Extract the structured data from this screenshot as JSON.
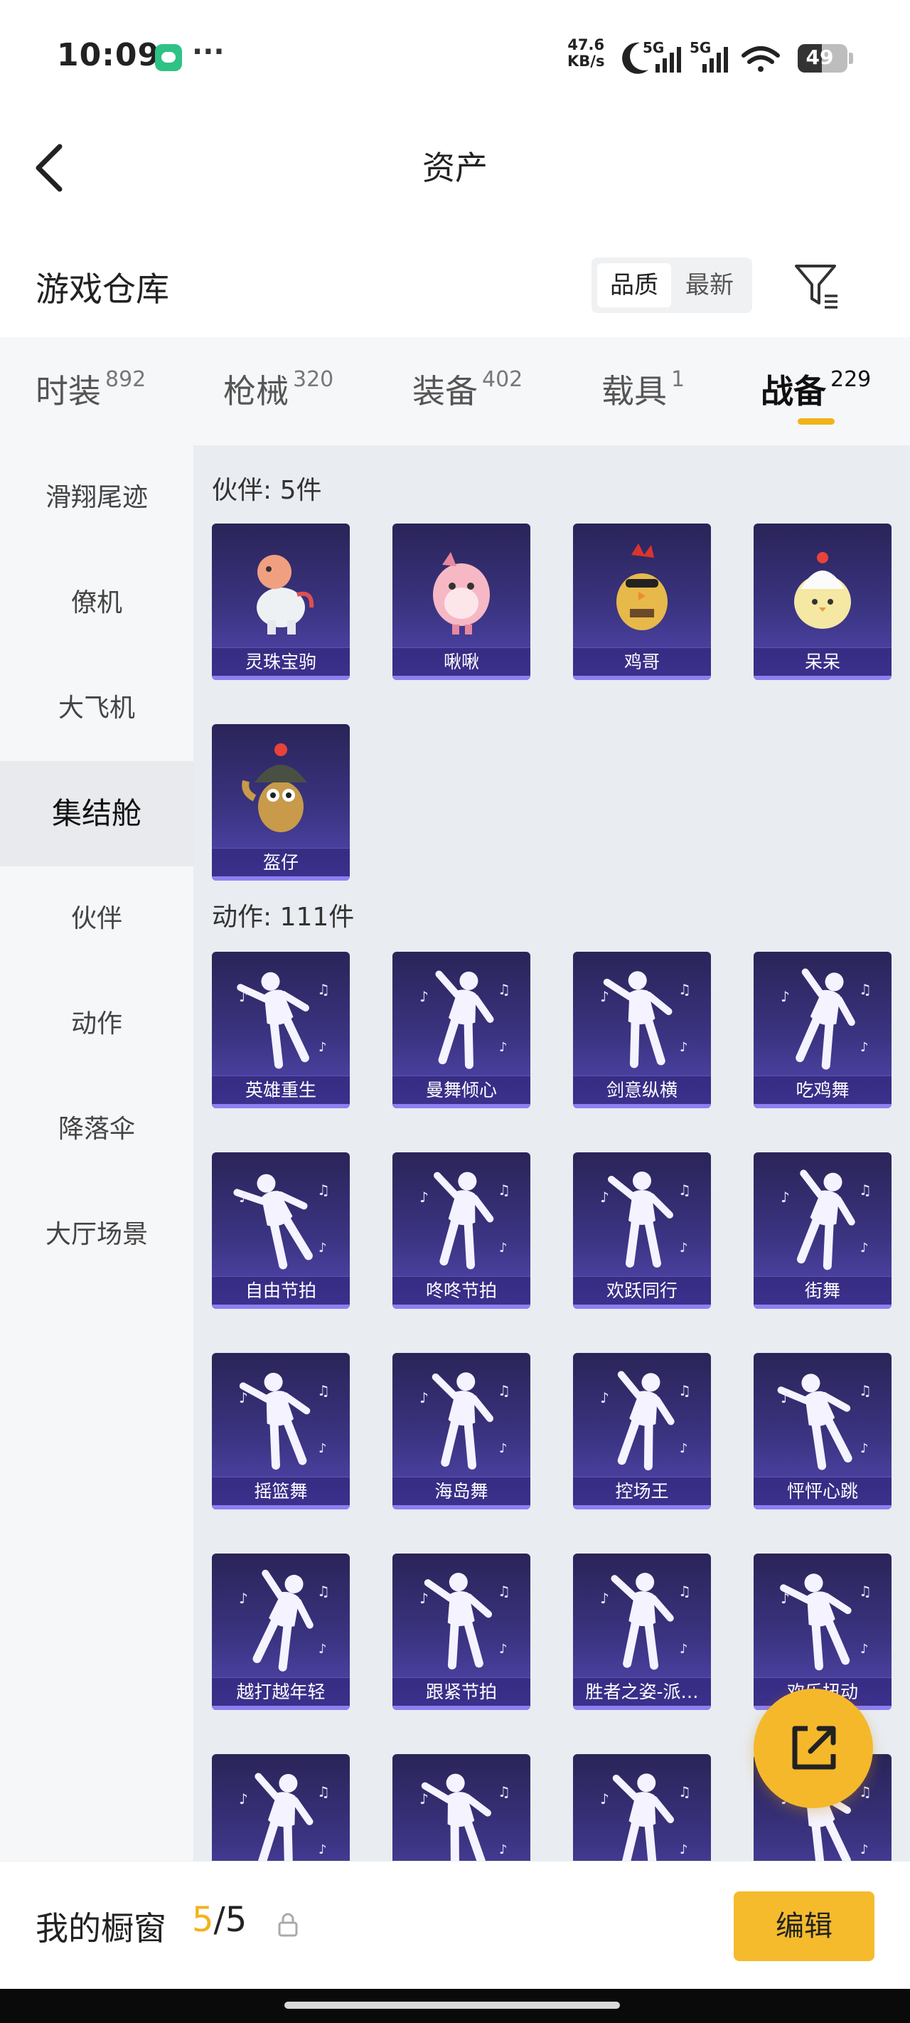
{
  "status_bar": {
    "time": "10:09",
    "dots": "···",
    "net_speed_value": "47.6",
    "net_speed_unit": "KB/s",
    "battery": "49"
  },
  "nav": {
    "title": "资产"
  },
  "warehouse": {
    "title": "游戏仓库",
    "sort_options": [
      "品质",
      "最新"
    ],
    "sort_selected": "品质"
  },
  "tabs": [
    {
      "label": "时装",
      "count": "892"
    },
    {
      "label": "枪械",
      "count": "320"
    },
    {
      "label": "装备",
      "count": "402"
    },
    {
      "label": "载具",
      "count": "1"
    },
    {
      "label": "战备",
      "count": "229",
      "active": true
    }
  ],
  "sidebar": [
    {
      "label": "滑翔尾迹"
    },
    {
      "label": "僚机"
    },
    {
      "label": "大飞机"
    },
    {
      "label": "集结舱",
      "active": true
    },
    {
      "label": "伙伴"
    },
    {
      "label": "动作"
    },
    {
      "label": "降落伞"
    },
    {
      "label": "大厅场景"
    }
  ],
  "sections": [
    {
      "title": "伙伴: 5件",
      "items": [
        {
          "name": "灵珠宝驹",
          "icon": "dragon-horse-companion"
        },
        {
          "name": "啾啾",
          "icon": "pink-bird-companion"
        },
        {
          "name": "鸡哥",
          "icon": "sunglasses-chicken-companion"
        },
        {
          "name": "呆呆",
          "icon": "yellow-chick-companion"
        },
        {
          "name": "盔仔",
          "icon": "helmet-chicken-companion"
        }
      ]
    },
    {
      "title": "动作: 111件",
      "items": [
        {
          "name": "英雄重生",
          "icon": "dance-pose"
        },
        {
          "name": "曼舞倾心",
          "icon": "dance-pose"
        },
        {
          "name": "剑意纵横",
          "icon": "dance-pose"
        },
        {
          "name": "吃鸡舞",
          "icon": "dance-pose"
        },
        {
          "name": "自由节拍",
          "icon": "dance-pose"
        },
        {
          "name": "咚咚节拍",
          "icon": "dance-pose"
        },
        {
          "name": "欢跃同行",
          "icon": "dance-pose"
        },
        {
          "name": "街舞",
          "icon": "dance-pose"
        },
        {
          "name": "摇篮舞",
          "icon": "dance-pose"
        },
        {
          "name": "海岛舞",
          "icon": "dance-pose"
        },
        {
          "name": "控场王",
          "icon": "dance-pose"
        },
        {
          "name": "怦怦心跳",
          "icon": "dance-pose"
        },
        {
          "name": "越打越年轻",
          "icon": "dance-pose"
        },
        {
          "name": "跟紧节拍",
          "icon": "dance-pose"
        },
        {
          "name": "胜者之姿-派…",
          "icon": "dance-pose"
        },
        {
          "name": "欢乐扭动",
          "icon": "dance-pose"
        },
        {
          "name": "",
          "icon": "dance-pose"
        },
        {
          "name": "",
          "icon": "dance-pose"
        },
        {
          "name": "",
          "icon": "dance-pose"
        },
        {
          "name": "",
          "icon": "dance-pose"
        }
      ]
    }
  ],
  "bottom_bar": {
    "label": "我的橱窗",
    "current": "5",
    "separator": "/",
    "total": "5",
    "edit_label": "编辑"
  },
  "colors": {
    "accent": "#f2b21b",
    "card_top": "#2a2458",
    "card_bottom": "#5549b4"
  }
}
